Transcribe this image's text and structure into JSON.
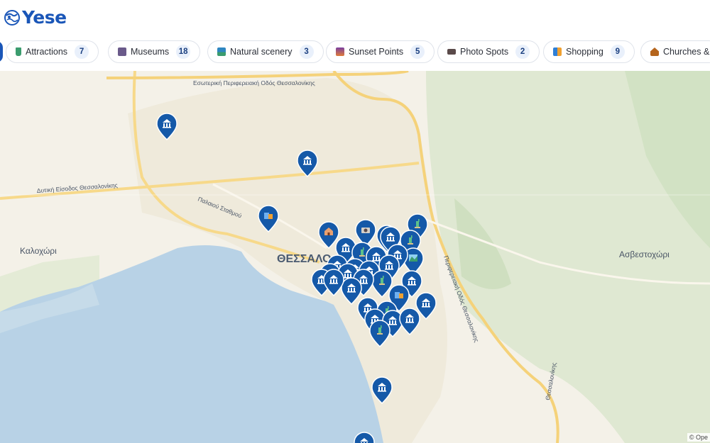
{
  "app": {
    "logo_text": "Yese"
  },
  "categories": [
    {
      "label": "Attractions",
      "count": "7",
      "icon": "statue-of-liberty-icon",
      "color": "#3b9c6e"
    },
    {
      "label": "Museums",
      "count": "18",
      "icon": "museum-icon",
      "color": "#6a5a8a"
    },
    {
      "label": "Natural scenery",
      "count": "3",
      "icon": "mountain-lake-icon",
      "color": "#2e86c1"
    },
    {
      "label": "Sunset Points",
      "count": "5",
      "icon": "sunset-icon",
      "color": "#e07b39"
    },
    {
      "label": "Photo Spots",
      "count": "2",
      "icon": "camera-icon",
      "color": "#5a4a4a"
    },
    {
      "label": "Shopping",
      "count": "9",
      "icon": "shopping-bags-icon",
      "color": "#2f7fd6"
    },
    {
      "label": "Churches & M",
      "count": "",
      "icon": "church-icon",
      "color": "#b5651d"
    }
  ],
  "map": {
    "labels": {
      "ring_road": "Εσωτερική Περιφερειακή Οδός Θεσσαλονίκης",
      "west_entry": "Δυτική Είσοδος Θεσσαλονίκης",
      "old_station": "Παλαιού Σταθμού",
      "city": "ΘΕΣΣΑΛΟ",
      "kalochori": "Καλοχώρι",
      "asvestochori": "Ασβεστοχώρι",
      "peripheral": "Περιφερειακή Οδός Θεσσαλονίκης",
      "east_road": "Θεσσαλονίκης"
    },
    "attribution": "© Ope",
    "pin_color": "#1559a8",
    "pins": [
      {
        "icon": "museum-icon"
      },
      {
        "icon": "museum-icon"
      },
      {
        "icon": "shopping-bags-icon"
      },
      {
        "icon": "church-icon"
      },
      {
        "icon": "photo-icon"
      },
      {
        "icon": "church-icon"
      },
      {
        "icon": "statue-of-liberty-icon"
      },
      {
        "icon": "statue-of-liberty-icon"
      },
      {
        "icon": "museum-icon"
      },
      {
        "icon": "museum-icon"
      },
      {
        "icon": "statue-of-liberty-icon"
      },
      {
        "icon": "museum-icon"
      },
      {
        "icon": "mountain-lake-icon"
      },
      {
        "icon": "museum-icon"
      },
      {
        "icon": "museum-icon"
      },
      {
        "icon": "museum-icon"
      },
      {
        "icon": "museum-icon"
      },
      {
        "icon": "museum-icon"
      },
      {
        "icon": "church-icon"
      },
      {
        "icon": "statue-of-liberty-icon"
      },
      {
        "icon": "museum-icon"
      },
      {
        "icon": "museum-icon"
      },
      {
        "icon": "museum-icon"
      },
      {
        "icon": "museum-icon"
      },
      {
        "icon": "museum-icon"
      },
      {
        "icon": "shopping-bags-icon"
      },
      {
        "icon": "museum-icon"
      },
      {
        "icon": "museum-icon"
      },
      {
        "icon": "statue-of-liberty-icon"
      },
      {
        "icon": "museum-icon"
      },
      {
        "icon": "museum-icon"
      },
      {
        "icon": "museum-icon"
      },
      {
        "icon": "statue-of-liberty-icon"
      },
      {
        "icon": "museum-icon"
      },
      {
        "icon": "museum-icon"
      },
      {
        "icon": "museum-icon"
      }
    ]
  }
}
